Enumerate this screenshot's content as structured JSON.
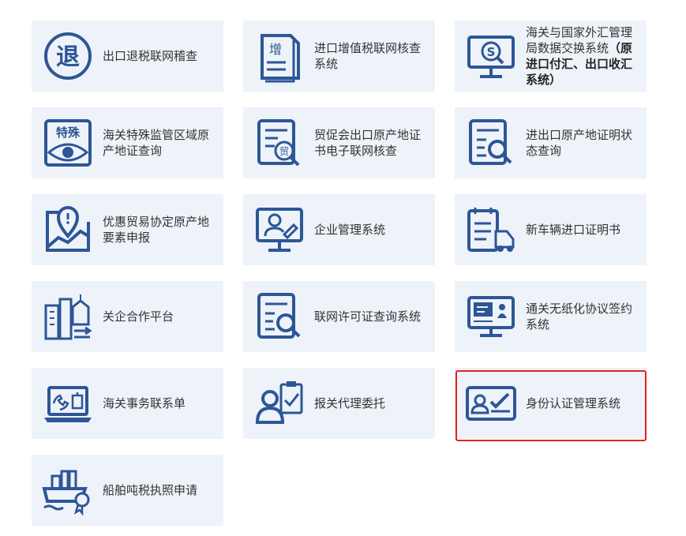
{
  "colors": {
    "icon": "#2c5697",
    "tile_bg": "#eef2f9",
    "text": "#333333",
    "highlight": "#e2231a"
  },
  "tiles": [
    {
      "label": "出口退税联网稽查",
      "icon": "tax-refund-icon",
      "icon_text": "退"
    },
    {
      "label": "进口增值税联网核查系统",
      "icon": "vat-document-icon",
      "icon_text": "增"
    },
    {
      "label": "海关与国家外汇管理局数据交换系统",
      "label_bold": "（原进口付汇、出口收汇系统）",
      "icon": "forex-monitor-icon"
    },
    {
      "label": "海关特殊监管区域原产地证查询",
      "icon": "special-zone-eye-icon",
      "icon_text": "特殊"
    },
    {
      "label": "贸促会出口原产地证书电子联网核查",
      "icon": "ccpit-certificate-search-icon",
      "icon_text": "贸"
    },
    {
      "label": "进出口原产地证明状态查询",
      "icon": "certificate-status-search-icon"
    },
    {
      "label": "优惠贸易协定原产地要素申报",
      "icon": "map-pin-chart-icon"
    },
    {
      "label": "企业管理系统",
      "icon": "user-monitor-icon"
    },
    {
      "label": "新车辆进口证明书",
      "icon": "vehicle-document-icon"
    },
    {
      "label": "关企合作平台",
      "icon": "customs-enterprise-building-icon"
    },
    {
      "label": "联网许可证查询系统",
      "icon": "license-search-icon"
    },
    {
      "label": "通关无纸化协议签约系统",
      "icon": "paperless-agreement-monitor-icon"
    },
    {
      "label": "海关事务联系单",
      "icon": "laptop-contact-icon"
    },
    {
      "label": "报关代理委托",
      "icon": "agent-clipboard-icon"
    },
    {
      "label": "身份认证管理系统",
      "icon": "identity-verification-card-icon",
      "selected": true
    },
    {
      "label": "船舶吨税执照申请",
      "icon": "ship-tonnage-license-icon"
    }
  ]
}
